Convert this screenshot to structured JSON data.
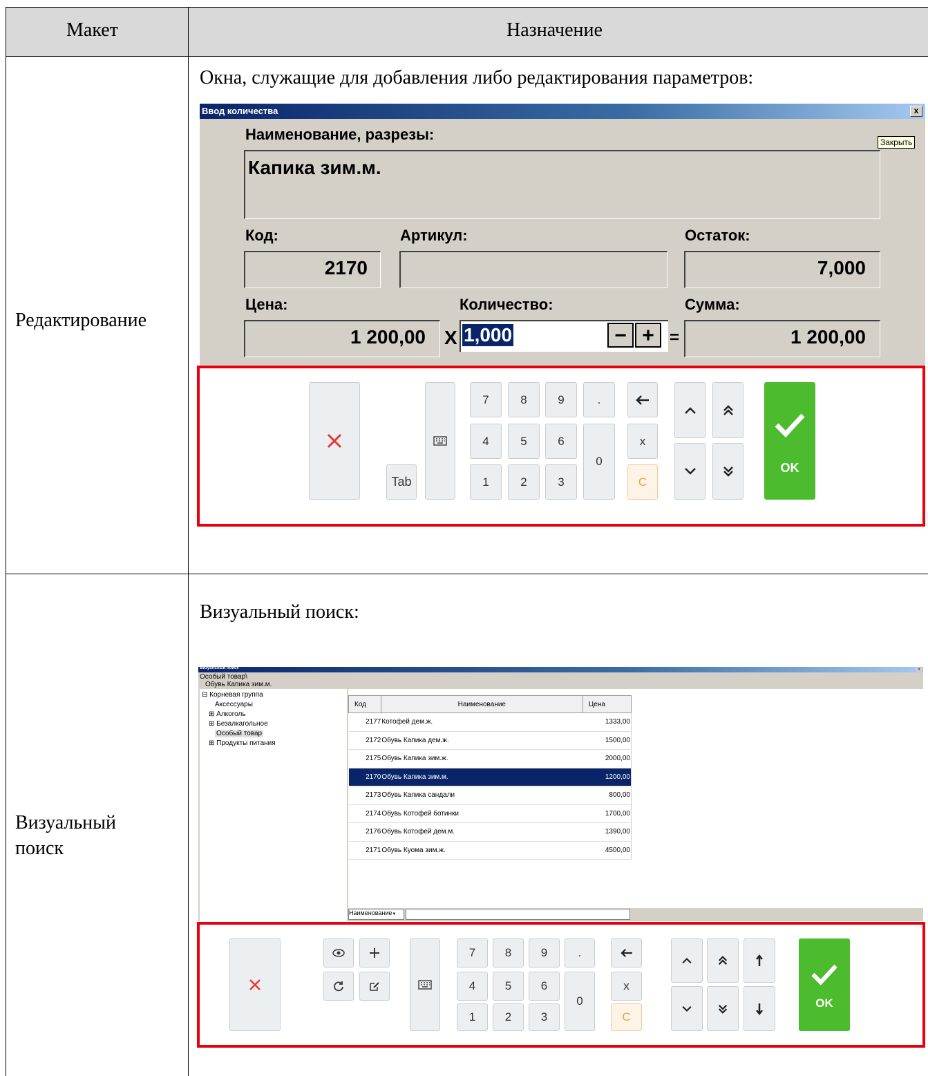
{
  "table": {
    "col_layout": "Макет",
    "col_purpose": "Назначение"
  },
  "row1": {
    "label": "Редактирование",
    "intro": "Окна, служащие для добавления либо редактирования параметров:",
    "dialog": {
      "title": "Ввод количества",
      "close_glyph": "x",
      "tooltip": "Закрыть",
      "name_label": "Наименование, разрезы:",
      "name_value": "Капика зим.м.",
      "code_label": "Код:",
      "code_value": "2170",
      "article_label": "Артикул:",
      "article_value": "",
      "stock_label": "Остаток:",
      "stock_value": "7,000",
      "price_label": "Цена:",
      "price_value": "1 200,00",
      "multiply": "X",
      "qty_label": "Количество:",
      "qty_value": "1,000",
      "minus": "−",
      "plus": "+",
      "equals": "=",
      "sum_label": "Сумма:",
      "sum_value": "1 200,00"
    },
    "keypad": {
      "tab": "Tab",
      "k7": "7",
      "k8": "8",
      "k9": "9",
      "dot": ".",
      "k4": "4",
      "k5": "5",
      "k6": "6",
      "x": "x",
      "k1": "1",
      "k2": "2",
      "k3": "3",
      "k0": "0",
      "c": "C",
      "ok": "OK"
    }
  },
  "row2": {
    "label_line1": "Визуальный",
    "label_line2": "поиск",
    "intro": "Визуальный поиск:",
    "window": {
      "title": "Визуальный поиск",
      "path1": "Особый товар\\",
      "path2": "Обувь Капика зим.м.",
      "tree": [
        "Корневая группа",
        "Аксессуары",
        "Алкоголь",
        "Безалкагольное",
        "Особый товар",
        "Продукты питания"
      ],
      "headers": {
        "code": "Код",
        "name": "Наименование",
        "price": "Цена"
      },
      "rows": [
        {
          "code": "2177",
          "name": "Котофей дем.ж.",
          "price": "1333,00"
        },
        {
          "code": "2172",
          "name": "Обувь Капика дем.ж.",
          "price": "1500,00"
        },
        {
          "code": "2175",
          "name": "Обувь Капика зим.ж.",
          "price": "2000,00"
        },
        {
          "code": "2170",
          "name": "Обувь Капика зим.м.",
          "price": "1200,00"
        },
        {
          "code": "2173",
          "name": "Обувь Капика сандали",
          "price": "800,00"
        },
        {
          "code": "2174",
          "name": "Обувь Котофей ботинки",
          "price": "1700,00"
        },
        {
          "code": "2176",
          "name": "Обувь Котофей дем.м.",
          "price": "1390,00"
        },
        {
          "code": "2171",
          "name": "Обувь Куома зим.ж.",
          "price": "4500,00"
        }
      ],
      "selected_code": "2170",
      "search_field": "Наименование"
    },
    "keypad": {
      "k7": "7",
      "k8": "8",
      "k9": "9",
      "dot": ".",
      "k4": "4",
      "k5": "5",
      "k6": "6",
      "x": "x",
      "k1": "1",
      "k2": "2",
      "k3": "3",
      "k0": "0",
      "c": "C",
      "ok": "OK"
    }
  }
}
